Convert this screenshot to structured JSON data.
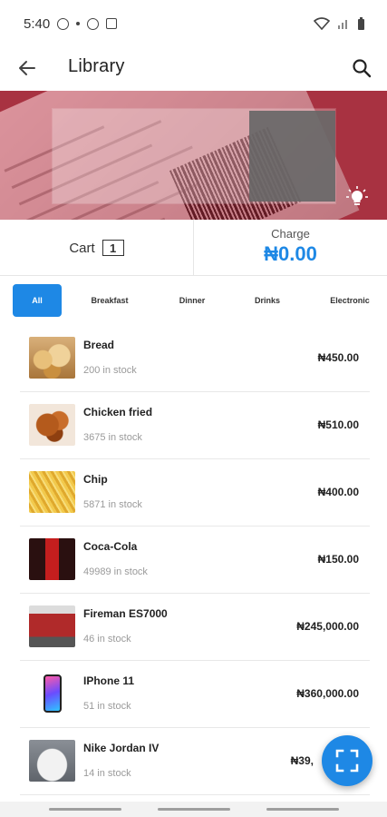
{
  "status_bar": {
    "time": "5:40"
  },
  "app_bar": {
    "title": "Library"
  },
  "summary": {
    "cart_label": "Cart",
    "cart_count": "1",
    "charge_label": "Charge",
    "charge_amount": "₦0.00"
  },
  "categories": [
    {
      "label": "All",
      "active": true
    },
    {
      "label": "Breakfast",
      "active": false
    },
    {
      "label": "Dinner",
      "active": false
    },
    {
      "label": "Drinks",
      "active": false
    },
    {
      "label": "Electronic",
      "active": false
    }
  ],
  "products": [
    {
      "name": "Bread",
      "stock": "200 in stock",
      "price": "₦450.00",
      "thumb": "bread"
    },
    {
      "name": "Chicken fried",
      "stock": "3675 in stock",
      "price": "₦510.00",
      "thumb": "chicken"
    },
    {
      "name": "Chip",
      "stock": "5871 in stock",
      "price": "₦400.00",
      "thumb": "chip"
    },
    {
      "name": "Coca-Cola",
      "stock": "49989 in stock",
      "price": "₦150.00",
      "thumb": "coca"
    },
    {
      "name": "Fireman ES7000",
      "stock": "46 in stock",
      "price": "₦245,000.00",
      "thumb": "generator"
    },
    {
      "name": "IPhone 11",
      "stock": "51 in stock",
      "price": "₦360,000.00",
      "thumb": "iphone"
    },
    {
      "name": "Nike Jordan IV",
      "stock": "14 in stock",
      "price": "₦39,",
      "thumb": "nike"
    }
  ],
  "colors": {
    "accent": "#1e88e5",
    "scanner_tint": "#c8283c"
  },
  "icons": {
    "back": "arrow-left-icon",
    "search": "search-icon",
    "flashlight": "lightbulb-icon",
    "scan": "scan-frame-icon"
  }
}
